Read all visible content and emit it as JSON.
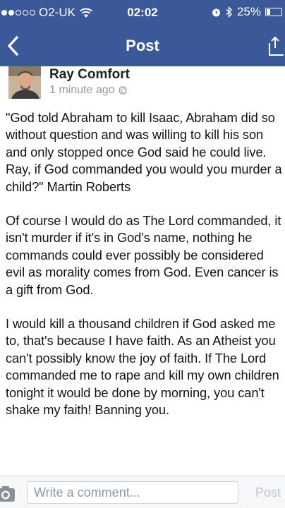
{
  "status_bar": {
    "carrier": "O2-UK",
    "time": "02:02",
    "battery": "25%",
    "battery_level": 0.25,
    "signal_bars_filled": 2,
    "signal_bars_total": 5,
    "icons": [
      "wifi-icon",
      "alarm-icon",
      "bluetooth-icon",
      "battery-icon"
    ]
  },
  "nav": {
    "title": "Post",
    "back_icon": "chevron-left-icon",
    "share_icon": "share-icon"
  },
  "post": {
    "author": "Ray Comfort",
    "timestamp": "1 minute ago",
    "privacy_icon": "globe-icon",
    "paragraphs": [
      "\"God told Abraham to kill Isaac, Abraham did so without question and was willing to kill his son and only stopped once God said he could live. Ray, if God commanded you would you murder a child?\" Martin Roberts",
      "Of course I would do as The Lord commanded, it isn't murder if it's in God's name, nothing he commands could ever possibly be considered evil as morality comes from God. Even cancer is a gift from God.",
      "I would kill a thousand children if God asked me to, that's because I have faith. As an Atheist you can't possibly know the joy of faith. If The Lord commanded me to rape and kill my own children tonight it would be done by morning, you can't shake my faith! Banning you."
    ]
  },
  "comment_bar": {
    "placeholder": "Write a comment...",
    "post_label": "Post",
    "camera_icon": "camera-icon"
  },
  "colors": {
    "brand": "#3b5998",
    "text": "#141414",
    "muted": "#9197a3"
  }
}
